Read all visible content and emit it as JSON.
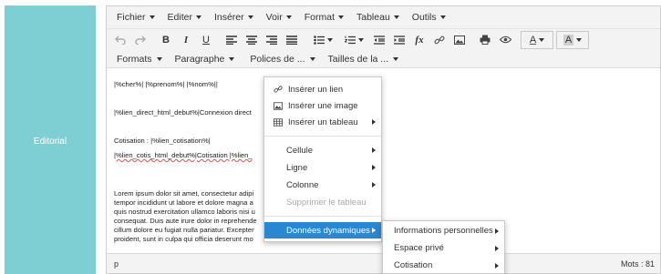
{
  "left_panel": {
    "label": "Editorial"
  },
  "menubar": {
    "items": [
      "Fichier",
      "Editer",
      "Insérer",
      "Voir",
      "Format",
      "Tableau",
      "Outils"
    ]
  },
  "toolbar": {
    "bold": "B",
    "italic": "I",
    "underline": "U",
    "function": "fx",
    "text_color": "A",
    "bg_color": "A"
  },
  "formatbar": {
    "items": [
      "Formats",
      "Paragraphe",
      "Polices de ...",
      "Tailles de la ..."
    ]
  },
  "content": {
    "line1": "|%cher%| |%prenom%| |%nom%||",
    "line2": "|%lien_direct_html_debut%|Connexion direct",
    "line3": "Cotisation : |%lien_cotisation%|",
    "line4": "|%lien_cotis_html_debut%|Cotisation |%lien_",
    "lorem": [
      "Lorem ipsum dolor sit amet, consectetur adipi",
      "tempor incididunt ut labore et dolore magna a",
      "quis nostrud exercitation ullamco laboris nisi u",
      "consequat. Duis aute irure dolor in reprehende",
      "cillum dolore eu fugiat nulla pariatur. Excepter",
      "proident, sunt in culpa qui officia deserunt mo"
    ]
  },
  "statusbar": {
    "path": "p",
    "words": "Mots : 81"
  },
  "context_menu": {
    "insert_link": "Insérer un lien",
    "insert_image": "Insérer une image",
    "insert_table": "Insérer un tableau",
    "cell": "Cellule",
    "row": "Ligne",
    "column": "Colonne",
    "delete_table": "Supprimer le tableau",
    "dynamic_data": "Données dynamiques"
  },
  "submenu": {
    "items": [
      "Informations personnelles",
      "Espace privé",
      "Cotisation"
    ]
  },
  "colors": {
    "panel": "#7ecfd4",
    "active_menu": "#2a87d0"
  }
}
